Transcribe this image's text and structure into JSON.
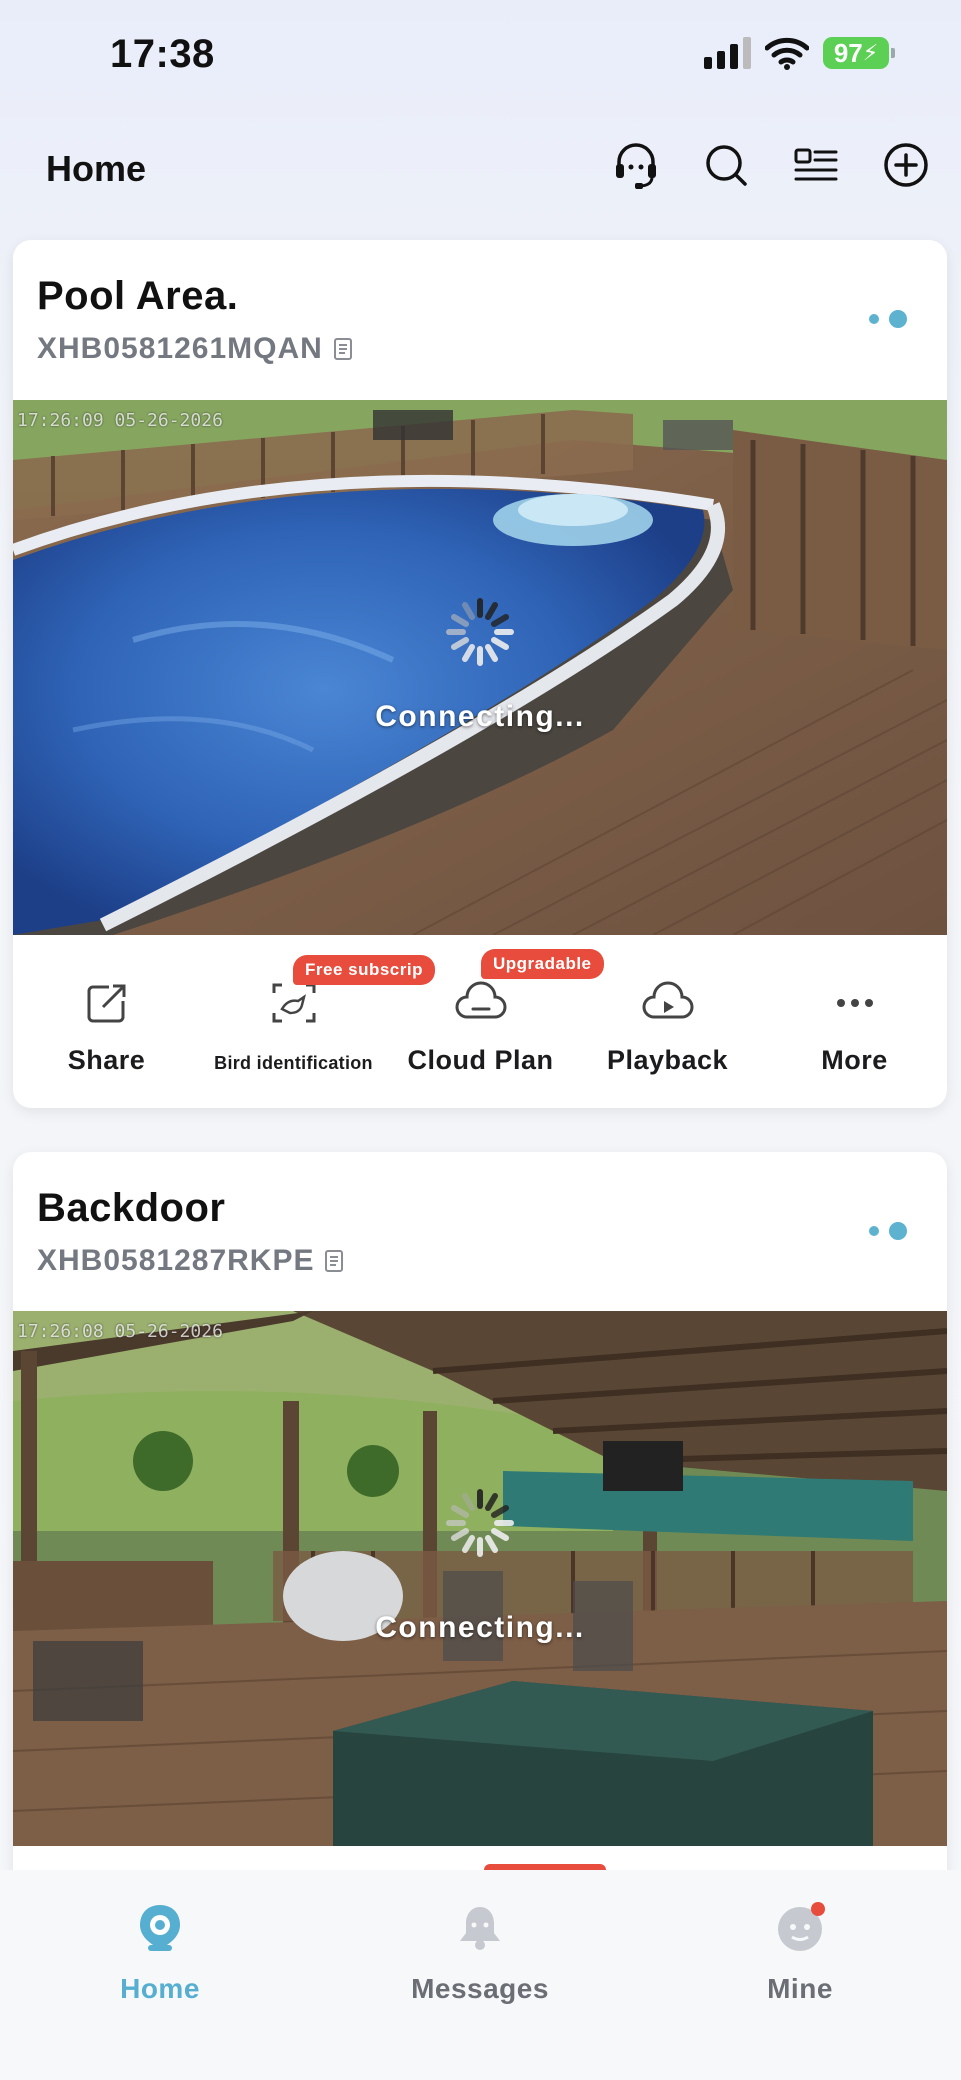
{
  "status_bar": {
    "time": "17:38",
    "battery": "97"
  },
  "header": {
    "title": "Home"
  },
  "cameras": [
    {
      "name": "Pool Area.",
      "serial": "XHB0581261MQAN",
      "timestamp": "17:26:09 05-26-2026",
      "state": "Connecting...",
      "actions": [
        {
          "label": "Share",
          "icon": "share-icon"
        },
        {
          "label": "Bird identification",
          "icon": "bird-icon",
          "badge": "Free subscrip"
        },
        {
          "label": "Cloud Plan",
          "icon": "cloud-icon",
          "badge": "Upgradable"
        },
        {
          "label": "Playback",
          "icon": "playback-icon"
        },
        {
          "label": "More",
          "icon": "more-icon"
        }
      ]
    },
    {
      "name": "Backdoor",
      "serial": "XHB0581287RKPE",
      "timestamp": "17:26:08 05-26-2026",
      "state": "Connecting..."
    }
  ],
  "tabbar": {
    "items": [
      {
        "label": "Home",
        "icon": "camera-home-icon",
        "active": true
      },
      {
        "label": "Messages",
        "icon": "bell-icon"
      },
      {
        "label": "Mine",
        "icon": "profile-icon"
      }
    ]
  },
  "colors": {
    "accent": "#56aed0",
    "badge": "#e74c3c",
    "battery": "#5bd054"
  }
}
